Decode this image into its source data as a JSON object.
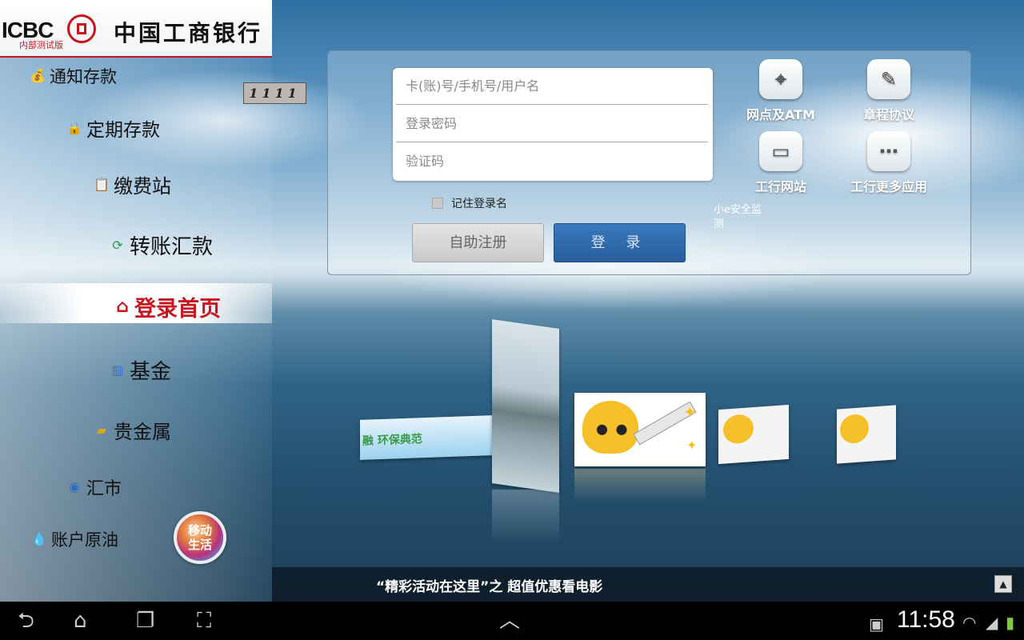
{
  "brand": {
    "abbr": "ICBC",
    "name": "中国工商银行",
    "edition": "内部测试版",
    "color": "#c8141e"
  },
  "sidebar": {
    "items": [
      {
        "label": "通知存款",
        "icon": "notice-deposit-icon"
      },
      {
        "label": "定期存款",
        "icon": "fixed-deposit-icon"
      },
      {
        "label": "缴费站",
        "icon": "payment-icon"
      },
      {
        "label": "转账汇款",
        "icon": "transfer-icon"
      },
      {
        "label": "登录首页",
        "icon": "home-icon",
        "active": true
      },
      {
        "label": "基金",
        "icon": "fund-chart-icon"
      },
      {
        "label": "贵金属",
        "icon": "gold-bar-icon"
      },
      {
        "label": "汇市",
        "icon": "forex-globe-icon"
      },
      {
        "label": "账户原油",
        "icon": "oil-drop-icon"
      }
    ],
    "mobile_life": {
      "line1": "移动",
      "line2": "生活"
    }
  },
  "login": {
    "account_placeholder": "卡(账)号/手机号/用户名",
    "password_placeholder": "登录密码",
    "captcha_placeholder": "验证码",
    "captcha_value": "1111",
    "remember_label": "记住登录名",
    "register_button": "自助注册",
    "login_button": "登 录"
  },
  "apps": [
    {
      "label": "网点及ATM",
      "icon": "map-pin-icon"
    },
    {
      "label": "章程协议",
      "icon": "document-icon"
    },
    {
      "label": "工行网站",
      "icon": "laptop-icon"
    },
    {
      "label": "工行更多应用",
      "icon": "more-apps-icon"
    }
  ],
  "security": "小e安全监测",
  "carousel": {
    "banner_text": "融 环保典范",
    "bottom_text": "“精彩活动在这里”之 超值优惠看电影"
  },
  "system_bar": {
    "time": "11:58"
  }
}
